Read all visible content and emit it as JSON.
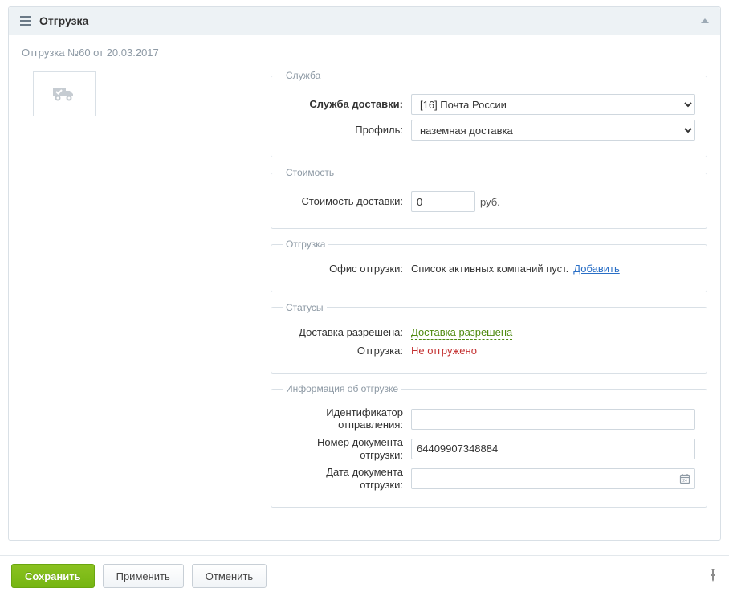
{
  "panel": {
    "title": "Отгрузка",
    "subtitle": "Отгрузка №60 от 20.03.2017"
  },
  "section_service": {
    "legend": "Служба",
    "delivery_service_label": "Служба доставки:",
    "delivery_service_value": "[16] Почта России",
    "profile_label": "Профиль:",
    "profile_value": "наземная доставка"
  },
  "section_cost": {
    "legend": "Стоимость",
    "cost_label": "Стоимость доставки:",
    "cost_value": "0",
    "currency": "руб."
  },
  "section_shipment": {
    "legend": "Отгрузка",
    "office_label": "Офис отгрузки:",
    "office_text": "Список активных компаний пуст.",
    "add_link": "Добавить"
  },
  "section_status": {
    "legend": "Статусы",
    "allowed_label": "Доставка разрешена:",
    "allowed_value": "Доставка разрешена",
    "shipment_label": "Отгрузка:",
    "shipment_value": "Не отгружено"
  },
  "section_info": {
    "legend": "Информация об отгрузке",
    "tracking_id_label": "Идентификатор отправления:",
    "tracking_id_value": "",
    "doc_number_label": "Номер документа отгрузки:",
    "doc_number_value": "64409907348884",
    "doc_date_label": "Дата документа отгрузки:",
    "doc_date_value": ""
  },
  "footer": {
    "save": "Сохранить",
    "apply": "Применить",
    "cancel": "Отменить"
  }
}
